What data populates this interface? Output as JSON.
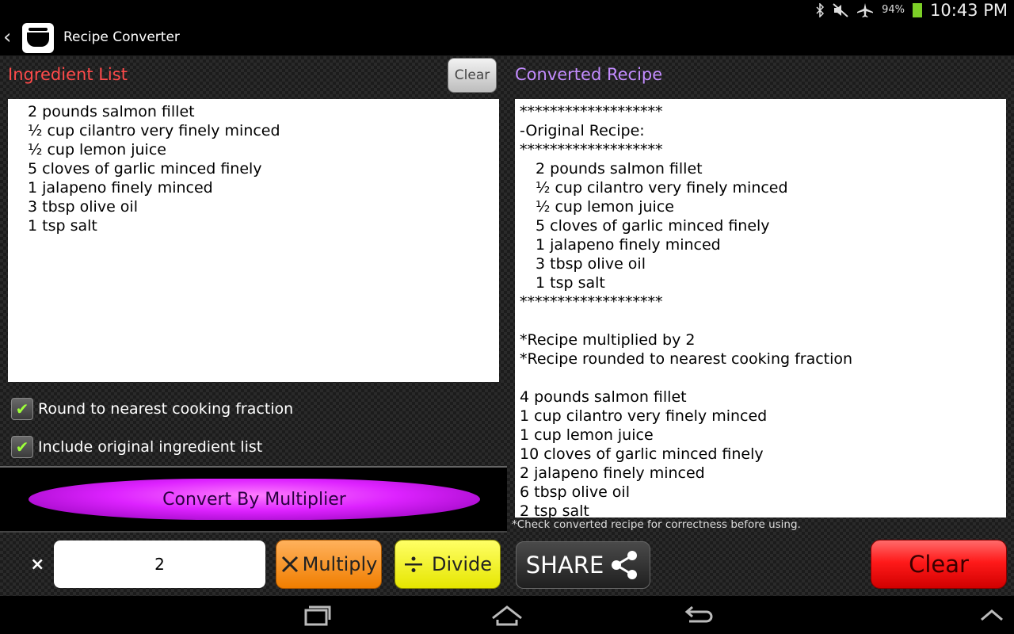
{
  "status": {
    "battery": "94%",
    "time": "10:43 PM"
  },
  "app": {
    "title": "Recipe Converter"
  },
  "left": {
    "heading": "Ingredient List",
    "clear_label": "Clear",
    "ingredients": [
      "2 pounds salmon fillet",
      "½ cup cilantro very finely minced",
      "½ cup lemon juice",
      "5 cloves of garlic minced finely",
      "1 jalapeno finely minced",
      "3 tbsp olive oil",
      "1 tsp salt"
    ],
    "round_label": "Round to nearest cooking fraction",
    "include_label": "Include original ingredient list",
    "convert_label": "Convert By Multiplier"
  },
  "right": {
    "heading": "Converted Recipe",
    "stars": "*******************",
    "original_header": "-Original Recipe:",
    "original": [
      "2 pounds salmon fillet",
      "½ cup cilantro very finely minced",
      "½ cup lemon juice",
      "5 cloves of garlic minced finely",
      "1 jalapeno finely minced",
      "3 tbsp olive oil",
      "1 tsp salt"
    ],
    "note1": "*Recipe multiplied by 2",
    "note2": "*Recipe rounded to nearest cooking fraction",
    "converted": [
      "4 pounds salmon fillet",
      "1 cup cilantro very finely minced",
      "1 cup lemon juice",
      "10 cloves of garlic minced finely",
      "2 jalapeno finely minced",
      "6 tbsp olive oil",
      "2 tsp salt"
    ],
    "check_note": "*Check converted recipe for correctness before using."
  },
  "bottom": {
    "x_label": "×",
    "multiplier": "2",
    "multiply_label": "Multiply",
    "divide_label": "Divide",
    "share_label": "SHARE",
    "clear_label": "Clear"
  }
}
